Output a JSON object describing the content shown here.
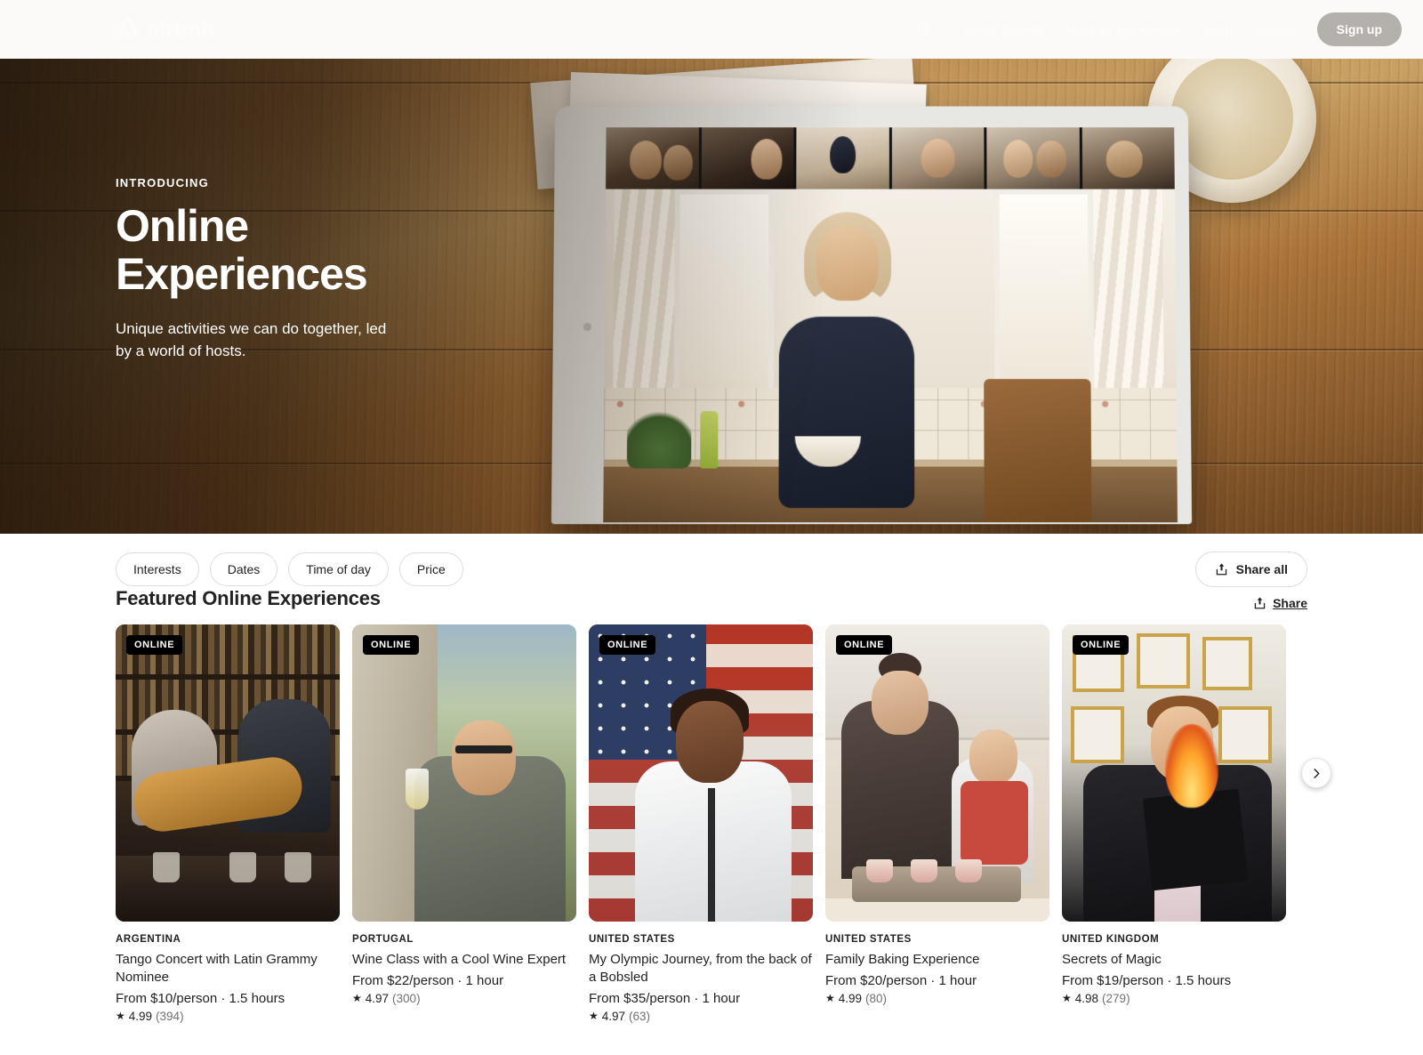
{
  "header": {
    "logo_text": "airbnb",
    "logo_icon": "airbnb-bel-logo-icon",
    "globe_icon": "globe-icon",
    "nav_items": [
      {
        "label": "Invite friends"
      },
      {
        "label": "Host an experience"
      },
      {
        "label": "Help"
      },
      {
        "label": "Log in"
      }
    ],
    "signup_label": "Sign up"
  },
  "hero": {
    "eyebrow": "INTRODUCING",
    "title_line1": "Online",
    "title_line2": "Experiences",
    "subtitle": "Unique activities we can do together, led by a world of hosts."
  },
  "filters": {
    "chips": [
      {
        "label": "Interests"
      },
      {
        "label": "Dates"
      },
      {
        "label": "Time of day"
      },
      {
        "label": "Price"
      }
    ],
    "share_all_label": "Share all",
    "share_icon": "share-upload-icon"
  },
  "section": {
    "title": "Featured Online Experiences",
    "share_label": "Share",
    "share_icon": "share-upload-icon",
    "next_icon": "chevron-right-icon"
  },
  "cards": [
    {
      "badge": "ONLINE",
      "location": "ARGENTINA",
      "title": "Tango Concert with Latin Grammy Nominee",
      "price": "From $10/person · 1.5 hours",
      "star": "★",
      "rating": "4.99",
      "reviews": "(394)"
    },
    {
      "badge": "ONLINE",
      "location": "PORTUGAL",
      "title": "Wine Class with a Cool Wine Expert",
      "price": "From $22/person · 1 hour",
      "star": "★",
      "rating": "4.97",
      "reviews": "(300)"
    },
    {
      "badge": "ONLINE",
      "location": "UNITED STATES",
      "title": "My Olympic Journey, from the back of a Bobsled",
      "price": "From $35/person · 1 hour",
      "star": "★",
      "rating": "4.97",
      "reviews": "(63)"
    },
    {
      "badge": "ONLINE",
      "location": "UNITED STATES",
      "title": "Family Baking Experience",
      "price": "From $20/person · 1 hour",
      "star": "★",
      "rating": "4.99",
      "reviews": "(80)"
    },
    {
      "badge": "ONLINE",
      "location": "UNITED KINGDOM",
      "title": "Secrets of Magic",
      "price": "From $19/person · 1.5 hours",
      "star": "★",
      "rating": "4.98",
      "reviews": "(279)"
    }
  ],
  "colors": {
    "accent_dark": "#222222",
    "muted": "#717171",
    "border": "#dddddd",
    "badge_bg": "#000000",
    "signup_bg": "#b4b0ab"
  }
}
